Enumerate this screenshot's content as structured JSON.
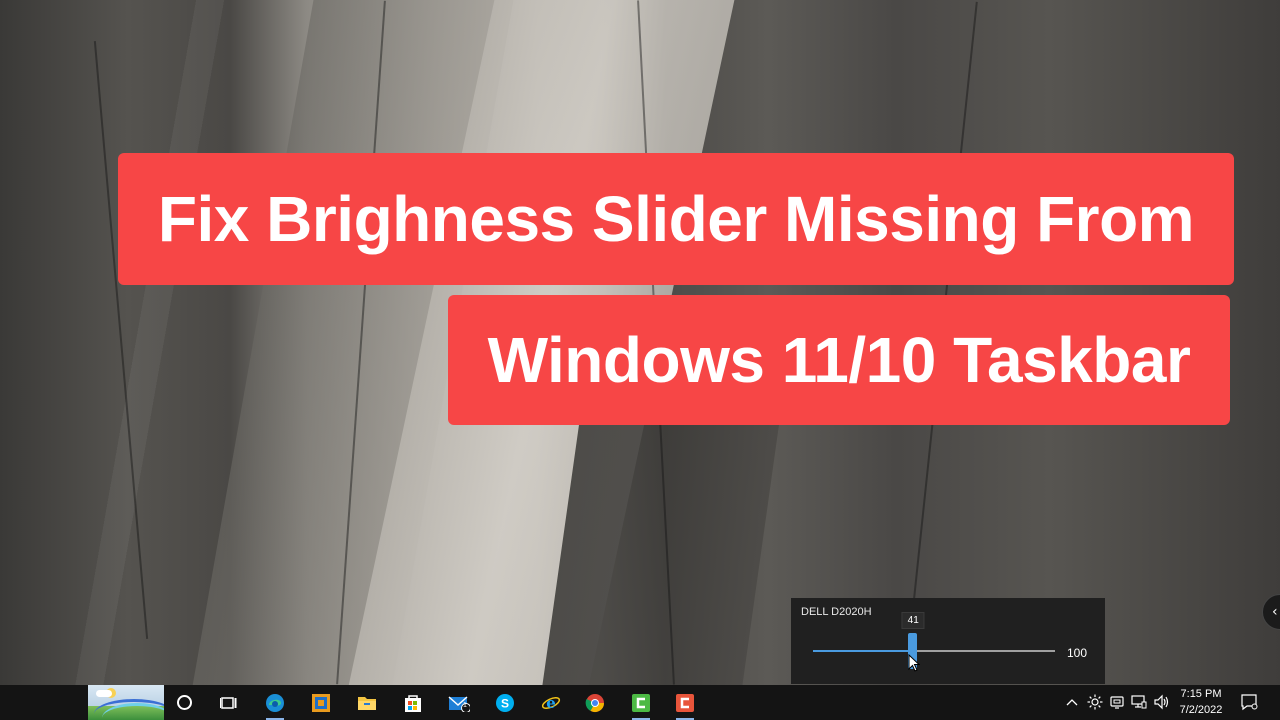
{
  "title": {
    "line1": "Fix Brighness Slider Missing From",
    "line2": "Windows 11/10 Taskbar"
  },
  "brightness_flyout": {
    "monitor_name": "DELL D2020H",
    "value": 41,
    "max_label": "100",
    "min": 0,
    "max": 100
  },
  "taskbar": {
    "pinned_icons": [
      "search-icon",
      "task-view-icon",
      "edge-icon",
      "remote-desktop-icon",
      "file-explorer-icon",
      "store-icon",
      "mail-icon",
      "skype-icon",
      "internet-explorer-icon",
      "chrome-icon",
      "camtasia-icon",
      "camtasia-recorder-icon"
    ],
    "mail_badge": "1",
    "tray_icons": [
      "chevron-up-icon",
      "brightness-icon",
      "onedrive-icon",
      "network-icon",
      "volume-icon"
    ],
    "clock": {
      "time": "7:15 PM",
      "date": "7/2/2022"
    }
  },
  "colors": {
    "banner": "#f74646",
    "accent": "#4a9be0",
    "taskbar": "#141414"
  }
}
